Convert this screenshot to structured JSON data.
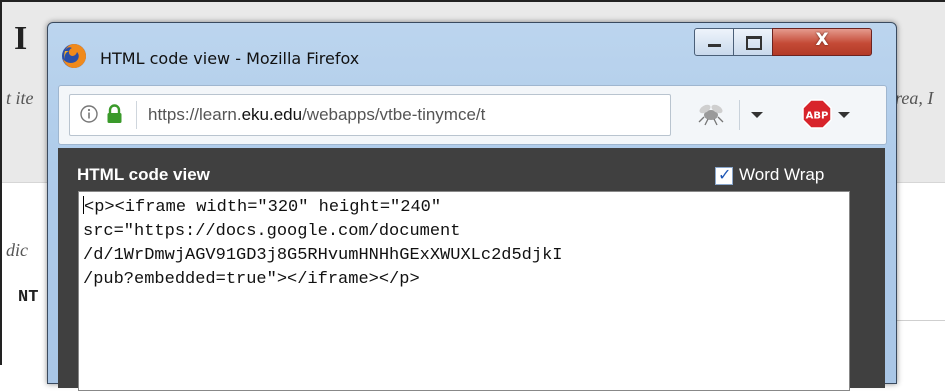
{
  "background": {
    "heading_fragment": "I",
    "italic_left": "t ite",
    "italic_right": "rea, I",
    "italic_left_2": "dic",
    "bold_left": "NT"
  },
  "popup": {
    "window_title": "HTML code view - Mozilla Firefox",
    "close_glyph": "X",
    "url_prefix": "https://learn.",
    "url_domain": "eku.edu",
    "url_suffix": "/webapps/vtbe-tinymce/t",
    "icons": {
      "logo": "firefox-logo",
      "info": "info-icon",
      "lock": "lock-icon",
      "bug": "bug-icon",
      "adblock": "adblock-plus-icon"
    },
    "adblock_label": "ABP"
  },
  "code_view": {
    "title": "HTML code view",
    "word_wrap_label": "Word Wrap",
    "word_wrap_checked": true,
    "code_lines": [
      "<p><iframe width=\"320\" height=\"240\"",
      "src=\"https://docs.google.com/document",
      "/d/1WrDmwjAGV91GD3j8G5RHvumHNHhGExXWUXLc2d5djkI",
      "/pub?embedded=true\"></iframe></p>"
    ]
  },
  "colors": {
    "panel_bg": "#404040",
    "close_red": "#c44a36",
    "lock_green": "#3a9a2a",
    "abp_red": "#d8242b"
  }
}
